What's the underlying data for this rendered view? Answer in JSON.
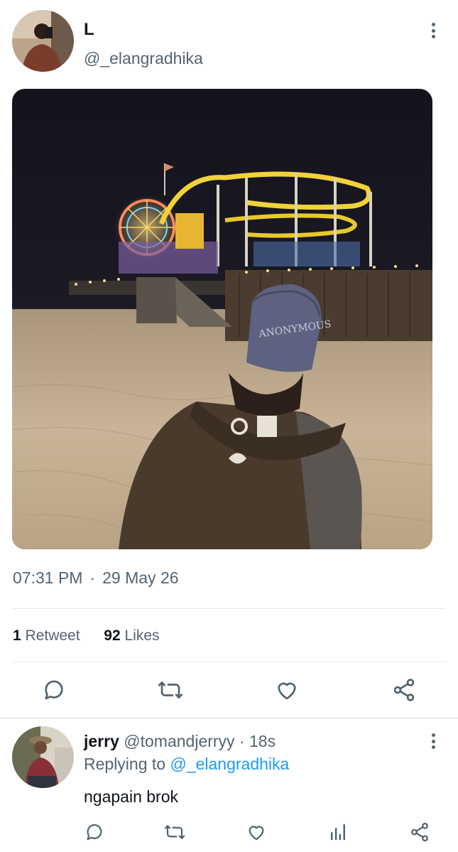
{
  "tweet": {
    "author_name": "L",
    "author_handle": "@_elangradhika",
    "time": "07:31 PM",
    "separator": "·",
    "date": "29 May 26",
    "retweet_count": "1",
    "retweet_label": "Retweet",
    "like_count": "92",
    "like_label": "Likes"
  },
  "actions": {
    "icons": [
      "reply-icon",
      "retweet-icon",
      "like-icon",
      "share-icon"
    ]
  },
  "reply": {
    "name": "jerry",
    "handle": "@tomandjerryy",
    "dot": "·",
    "age": "18s",
    "replying_prefix": "Replying to",
    "replying_to": "@_elangradhika",
    "text": "ngapain brok",
    "icons": [
      "reply-icon",
      "retweet-icon",
      "like-icon",
      "analytics-icon",
      "share-icon"
    ]
  },
  "colors": {
    "text_primary": "#0f1419",
    "text_secondary": "#536471",
    "link": "#1d9bf0",
    "divider": "#e4e8eb"
  }
}
